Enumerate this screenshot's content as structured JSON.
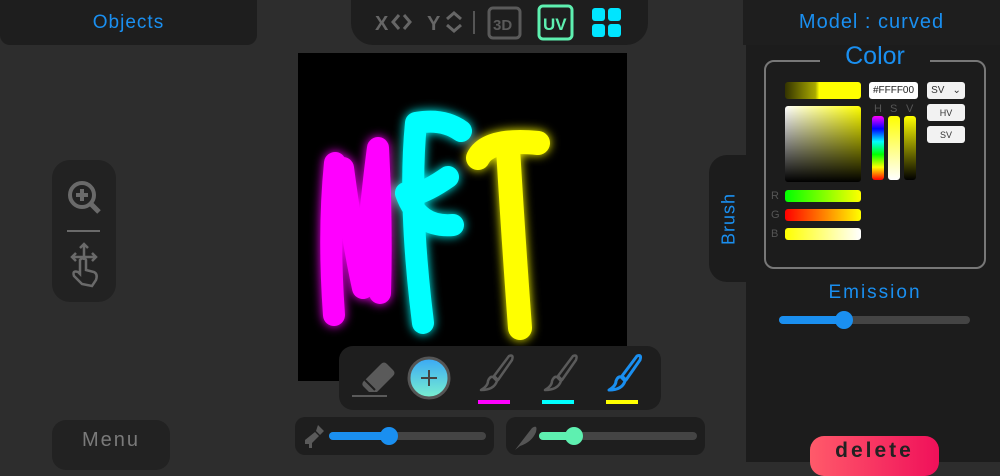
{
  "header": {
    "objects_label": "Objects",
    "model_label": "Model : curved"
  },
  "toolbar": {
    "items": [
      {
        "label": "X",
        "icon": "x-axis-arrows-icon"
      },
      {
        "label": "Y",
        "icon": "y-axis-arrows-icon"
      },
      {
        "label": "3D",
        "icon": "3d-icon"
      },
      {
        "label": "UV",
        "icon": "uv-icon",
        "active": true
      },
      {
        "icon": "grid-icon"
      }
    ]
  },
  "left_tools": {
    "zoom": "zoom-in-icon",
    "pan": "pan-gesture-icon"
  },
  "menu_label": "Menu",
  "canvas": {
    "drawing_text": "NFT"
  },
  "brush_tab_label": "Brush",
  "brushes": [
    {
      "icon": "eraser-icon"
    },
    {
      "icon": "add-icon"
    },
    {
      "icon": "brush-icon",
      "color": "#ff00ff"
    },
    {
      "icon": "brush-icon",
      "color": "#00ffff"
    },
    {
      "icon": "brush-icon",
      "color": "#ffff00",
      "active": true
    }
  ],
  "sliders": {
    "brush_size": 0.38,
    "softness": 0.22,
    "emission": 0.34
  },
  "color": {
    "title": "Color",
    "hex": "#FFFF00",
    "mode": "SV",
    "mode_buttons": [
      "HV",
      "SV"
    ],
    "hsv_labels": [
      "H",
      "S",
      "V"
    ],
    "rgb_labels": [
      "R",
      "G",
      "B"
    ],
    "r": 255,
    "g": 255,
    "b": 0
  },
  "emission_label": "Emission",
  "delete_label": "delete",
  "colors": {
    "accent": "#1a8ff0",
    "uv": "#5ef0b0",
    "grid": "#00e5ff"
  }
}
